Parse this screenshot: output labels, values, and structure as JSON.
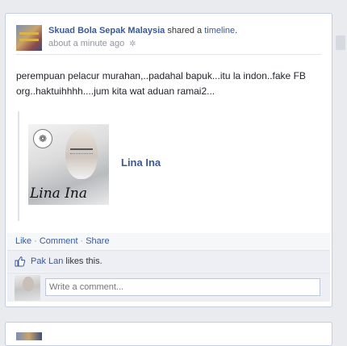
{
  "post": {
    "author": "Skuad Bola Sepak Malaysia",
    "action_text": " shared a ",
    "action_link": "timeline",
    "action_suffix": ".",
    "timestamp": "about a minute ago",
    "message": "perempuan pelacur murahan,..padahal bapuk...itu la indon..fake FB org..haktuihhhh....jum kita wat aduan ramai2...",
    "shared": {
      "title": "Lina Ina",
      "image_signature": "Lina Ina"
    },
    "actions": {
      "like": "Like",
      "comment": "Comment",
      "share": "Share"
    },
    "likes": {
      "name": "Pak Lan",
      "suffix": " likes this."
    },
    "comment_box": {
      "placeholder": "Write a comment..."
    }
  },
  "colors": {
    "link": "#3b5998",
    "background": "#e9ebee",
    "card_border": "#c4cde0"
  },
  "icons": {
    "privacy": "globe-gear-icon",
    "like": "thumbs-up-icon"
  }
}
